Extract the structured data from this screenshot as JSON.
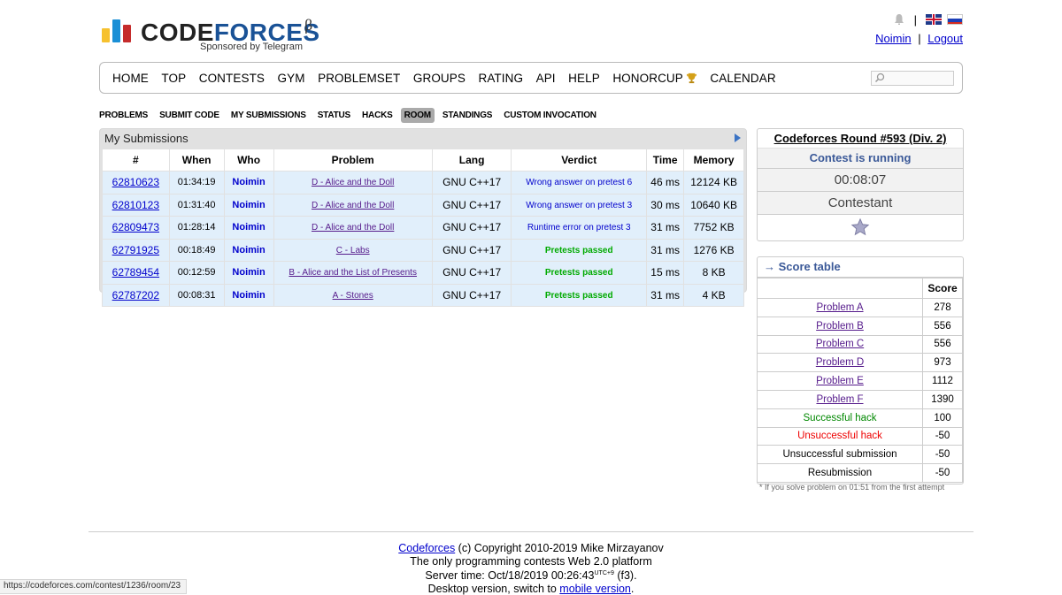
{
  "header": {
    "logo_word1": "CODE",
    "logo_word2": "FORCES",
    "logo_beta": "β",
    "logo_sub": "Sponsored by Telegram",
    "user": "Noimin",
    "separator": "|",
    "logout": "Logout"
  },
  "menu": {
    "items": [
      "HOME",
      "TOP",
      "CONTESTS",
      "GYM",
      "PROBLEMSET",
      "GROUPS",
      "RATING",
      "API",
      "HELP",
      "HONORCUP",
      "CALENDAR"
    ]
  },
  "subnav": {
    "items": [
      "PROBLEMS",
      "SUBMIT CODE",
      "MY SUBMISSIONS",
      "STATUS",
      "HACKS",
      "ROOM",
      "STANDINGS",
      "CUSTOM INVOCATION"
    ],
    "active": "ROOM"
  },
  "submissions": {
    "title": "My Submissions",
    "headers": [
      "#",
      "When",
      "Who",
      "Problem",
      "Lang",
      "Verdict",
      "Time",
      "Memory"
    ],
    "rows": [
      {
        "id": "62810623",
        "when": "01:34:19",
        "who": "Noimin",
        "problem": "D - Alice and the Doll",
        "lang": "GNU C++17",
        "verdict": "Wrong answer on pretest 6",
        "ok": false,
        "time": "46 ms",
        "memory": "12124 KB"
      },
      {
        "id": "62810123",
        "when": "01:31:40",
        "who": "Noimin",
        "problem": "D - Alice and the Doll",
        "lang": "GNU C++17",
        "verdict": "Wrong answer on pretest 3",
        "ok": false,
        "time": "30 ms",
        "memory": "10640 KB"
      },
      {
        "id": "62809473",
        "when": "01:28:14",
        "who": "Noimin",
        "problem": "D - Alice and the Doll",
        "lang": "GNU C++17",
        "verdict": "Runtime error on pretest 3",
        "ok": false,
        "time": "31 ms",
        "memory": "7752 KB"
      },
      {
        "id": "62791925",
        "when": "00:18:49",
        "who": "Noimin",
        "problem": "C - Labs",
        "lang": "GNU C++17",
        "verdict": "Pretests passed",
        "ok": true,
        "time": "31 ms",
        "memory": "1276 KB"
      },
      {
        "id": "62789454",
        "when": "00:12:59",
        "who": "Noimin",
        "problem": "B - Alice and the List of Presents",
        "lang": "GNU C++17",
        "verdict": "Pretests passed",
        "ok": true,
        "time": "15 ms",
        "memory": "8 KB"
      },
      {
        "id": "62787202",
        "when": "00:08:31",
        "who": "Noimin",
        "problem": "A - Stones",
        "lang": "GNU C++17",
        "verdict": "Pretests passed",
        "ok": true,
        "time": "31 ms",
        "memory": "4 KB"
      }
    ]
  },
  "contest": {
    "name": "Codeforces Round #593 (Div. 2)",
    "status": "Contest is running",
    "timer": "00:08:07",
    "role": "Contestant"
  },
  "score_table": {
    "title": "→ Score table",
    "header": "Score",
    "rows": [
      {
        "label": "Problem A",
        "score": "278",
        "kind": "link"
      },
      {
        "label": "Problem B",
        "score": "556",
        "kind": "link"
      },
      {
        "label": "Problem C",
        "score": "556",
        "kind": "link"
      },
      {
        "label": "Problem D",
        "score": "973",
        "kind": "link"
      },
      {
        "label": "Problem E",
        "score": "1112",
        "kind": "link"
      },
      {
        "label": "Problem F",
        "score": "1390",
        "kind": "link"
      },
      {
        "label": "Successful hack",
        "score": "100",
        "kind": "green"
      },
      {
        "label": "Unsuccessful hack",
        "score": "-50",
        "kind": "red"
      },
      {
        "label": "Unsuccessful submission",
        "score": "-50",
        "kind": "plain"
      },
      {
        "label": "Resubmission",
        "score": "-50",
        "kind": "plain"
      }
    ],
    "footnote": "* If you solve problem on 01:51 from the first attempt"
  },
  "footer": {
    "line1_link": "Codeforces",
    "line1_rest": " (c) Copyright 2010-2019 Mike Mirzayanov",
    "line2": "The only programming contests Web 2.0 platform",
    "line3_a": "Server time: Oct/18/2019 00:26:43",
    "line3_sup": "UTC+9",
    "line3_b": " (f3).",
    "line4_a": "Desktop version, switch to ",
    "line4_link": "mobile version",
    "line4_b": "."
  },
  "statusbar": "https://codeforces.com/contest/1236/room/23"
}
